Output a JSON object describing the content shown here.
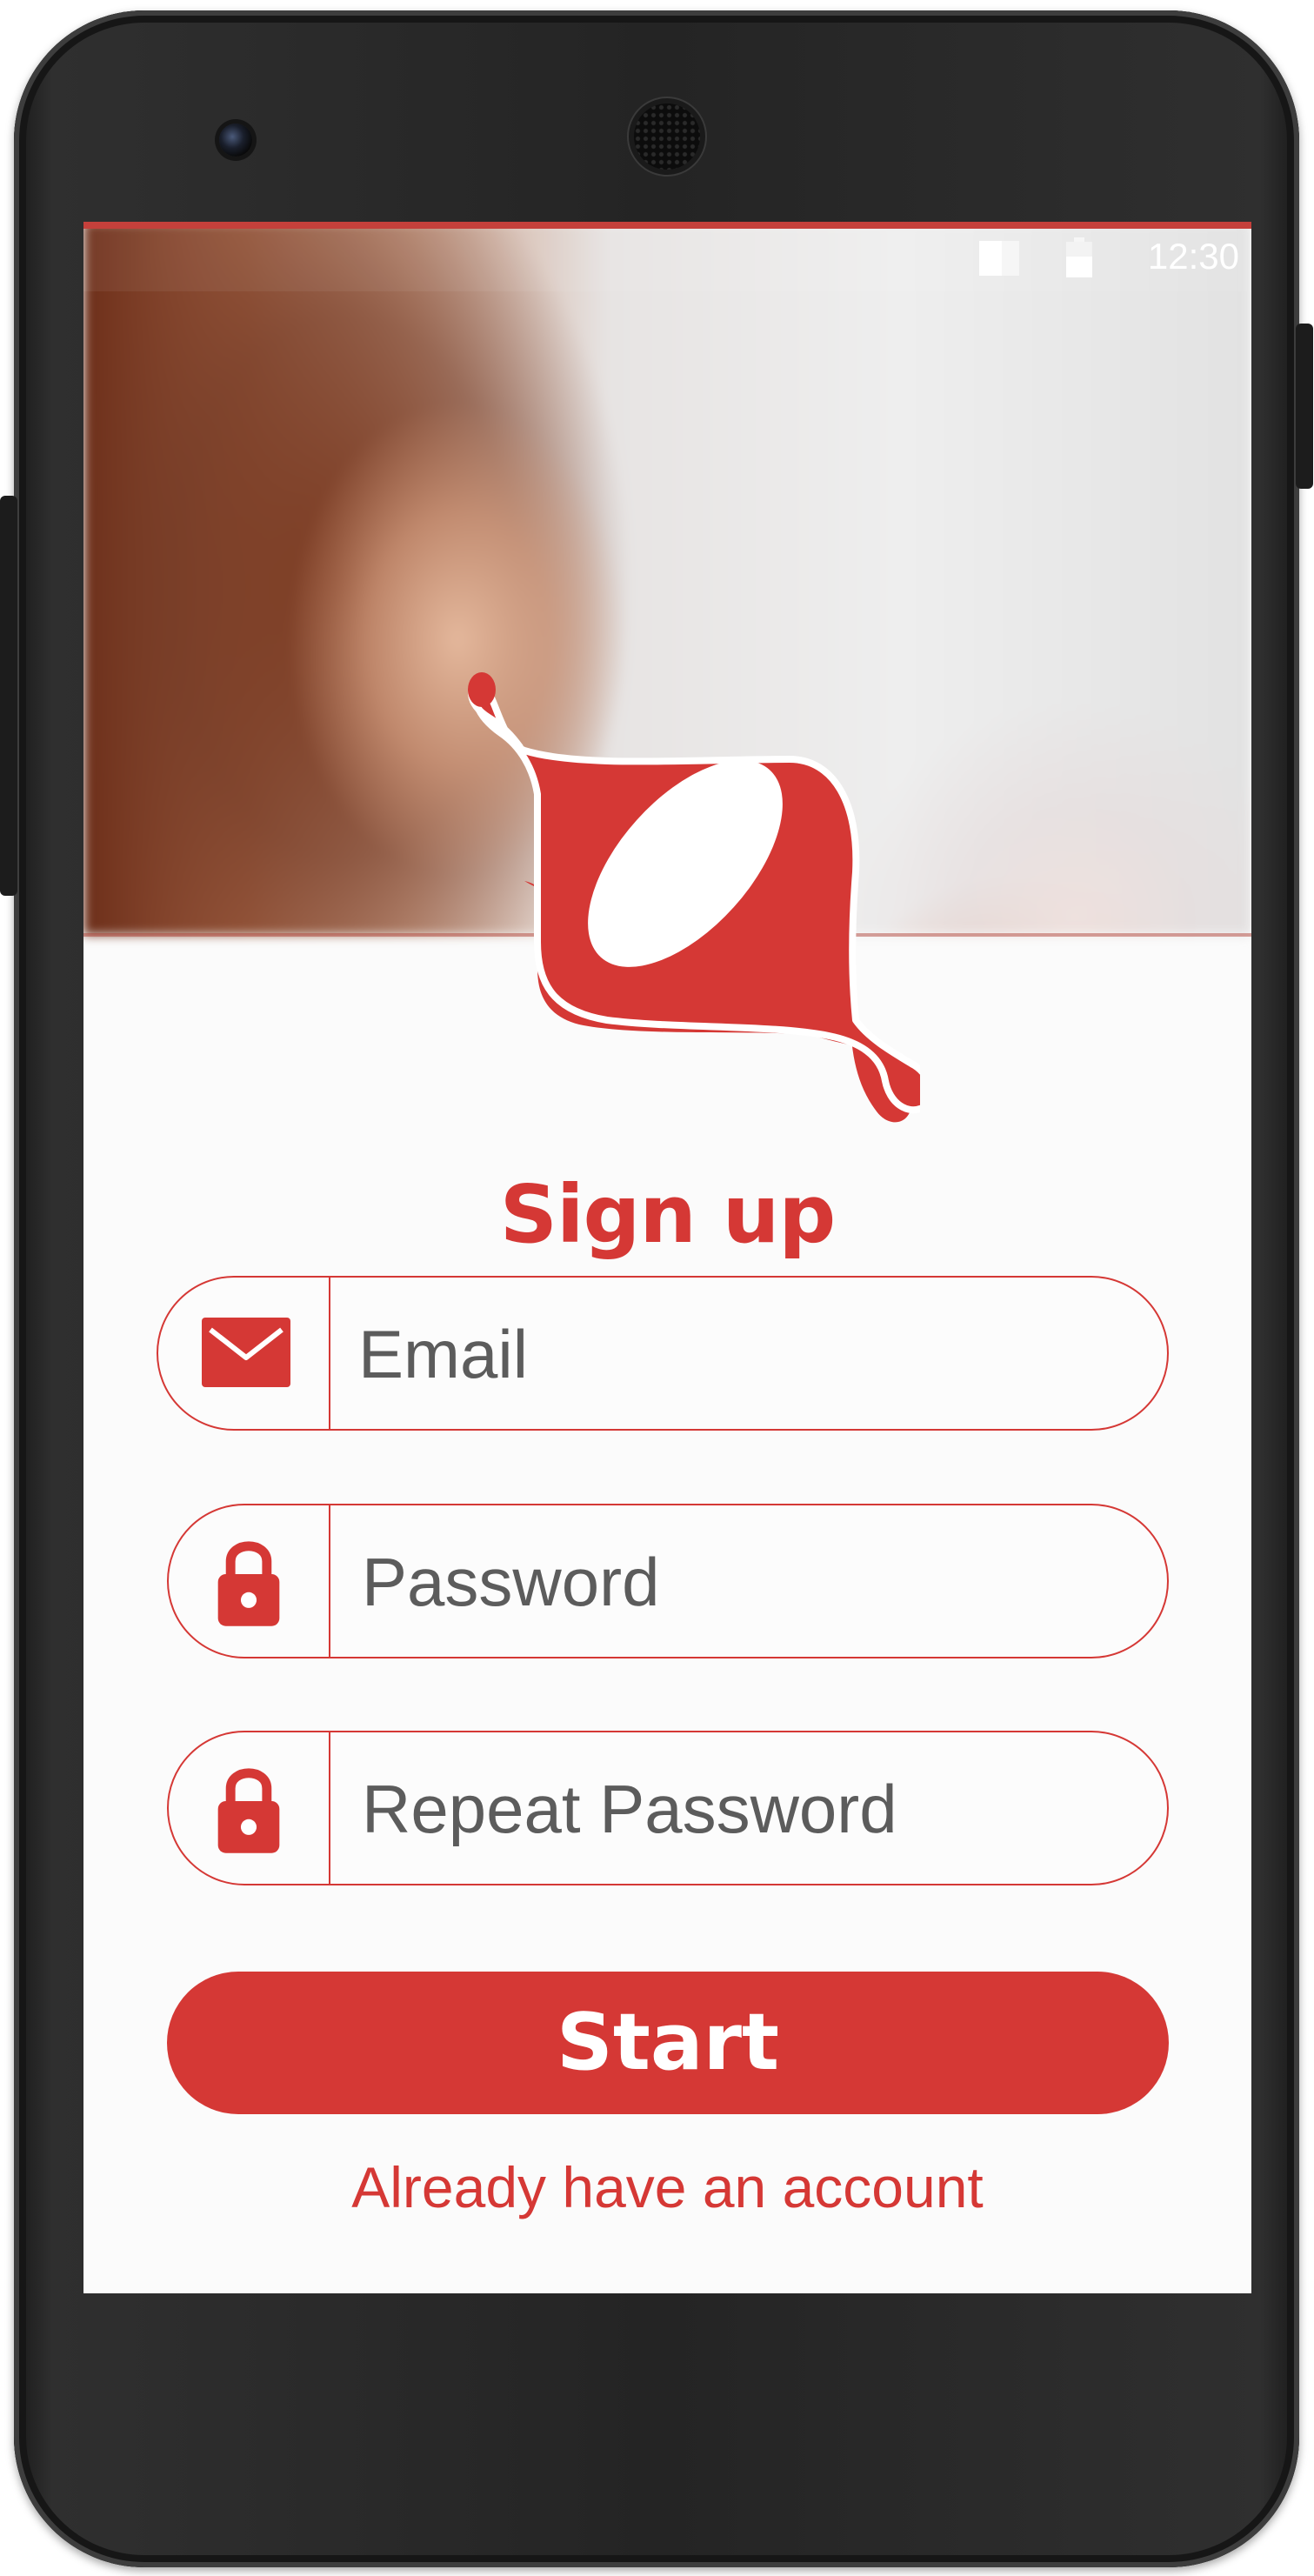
{
  "status_bar": {
    "time": "12:30",
    "signal_icon": "signal-icon",
    "battery_icon": "battery-icon"
  },
  "hero": {
    "image": "blurred photo of smiling woman holding phone"
  },
  "brand": {
    "logo_icon": "brand-logo-icon",
    "accent_color": "#d53835"
  },
  "signup": {
    "title": "Sign up",
    "fields": [
      {
        "icon": "mail-icon",
        "placeholder": "Email",
        "value": ""
      },
      {
        "icon": "lock-icon",
        "placeholder": "Password",
        "value": ""
      },
      {
        "icon": "lock-icon",
        "placeholder": "Repeat Password",
        "value": ""
      }
    ],
    "start_label": "Start",
    "login_link": "Already have an account"
  }
}
